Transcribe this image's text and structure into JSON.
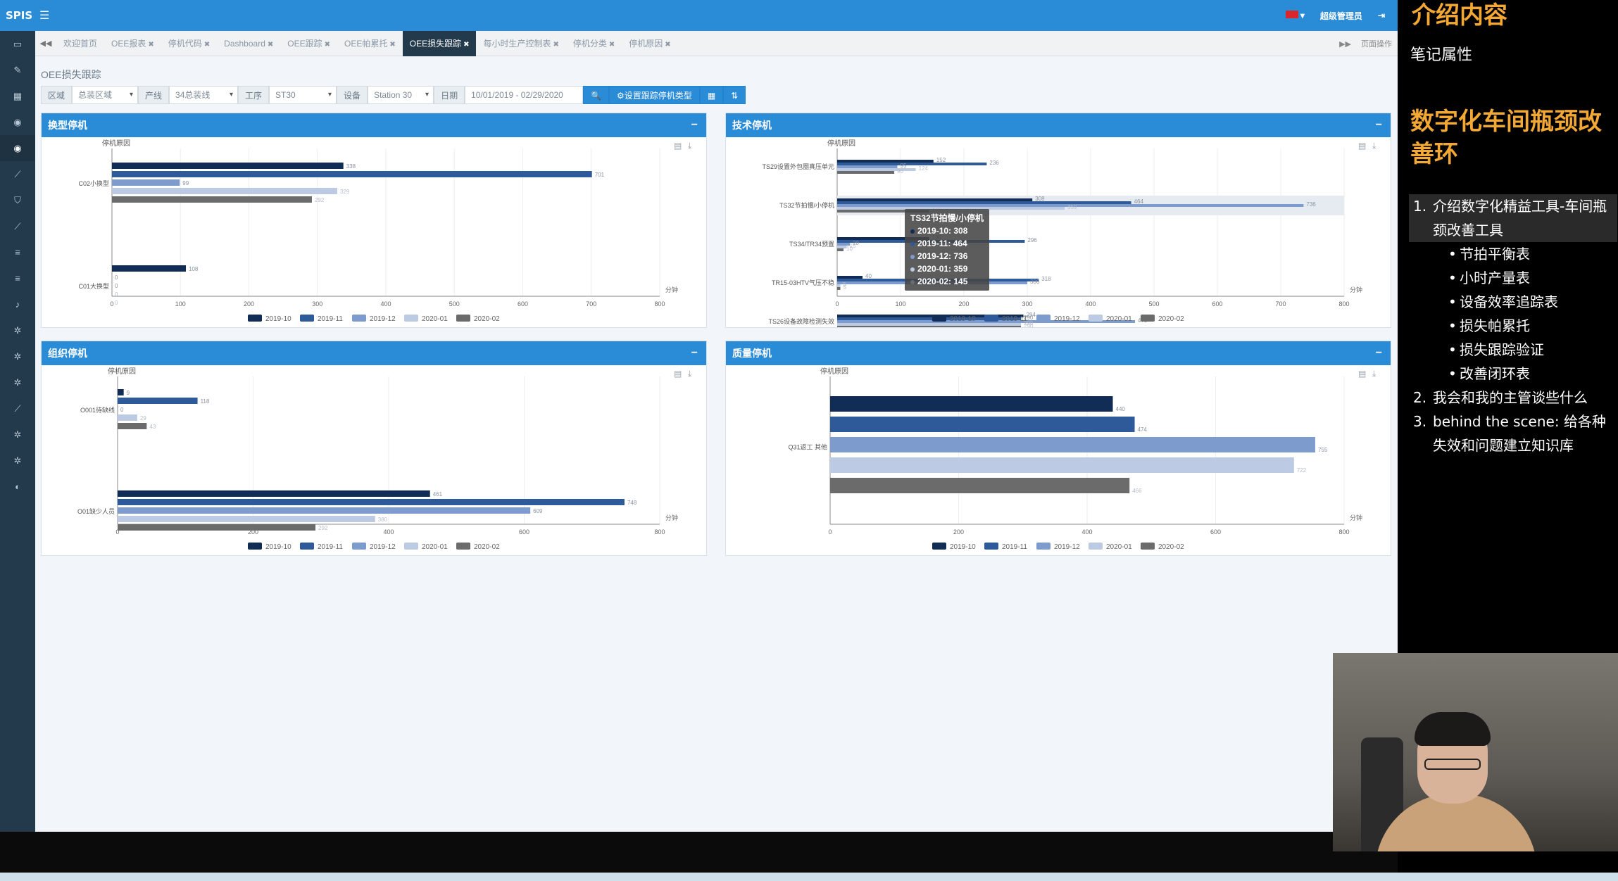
{
  "app": {
    "logo": "SPIS",
    "user_name": "超级管理员",
    "tabs": [
      {
        "label": "欢迎首页",
        "closable": false
      },
      {
        "label": "OEE报表",
        "closable": true
      },
      {
        "label": "停机代码",
        "closable": true
      },
      {
        "label": "Dashboard",
        "closable": true
      },
      {
        "label": "OEE跟踪",
        "closable": true
      },
      {
        "label": "OEE帕累托",
        "closable": true
      },
      {
        "label": "OEE损失跟踪",
        "closable": true
      },
      {
        "label": "每小时生产控制表",
        "closable": true
      },
      {
        "label": "停机分类",
        "closable": true
      },
      {
        "label": "停机原因",
        "closable": true
      }
    ],
    "active_tab": 6,
    "tab_actions": "页面操作",
    "page_title": "OEE损失跟踪",
    "filters": {
      "area_label": "区域",
      "area_value": "总装区域",
      "line_label": "产线",
      "line_value": "34总装线",
      "station_label": "工序",
      "station_value": "ST30",
      "device_label": "设备",
      "device_value": "Station 30",
      "date_label": "日期",
      "date_value": "10/01/2019 - 02/29/2020",
      "set_type_button": "设置跟踪停机类型"
    },
    "sidebar_icons": [
      "monitor-icon",
      "edit-icon",
      "calendar-icon",
      "camera-icon",
      "camera-icon",
      "chart-icon",
      "shield-icon",
      "chart-icon",
      "list-icon",
      "list-icon",
      "bell-icon",
      "gear-icon",
      "gear-icon",
      "gear-icon",
      "chart-icon",
      "gear-icon",
      "gears-icon",
      "dashboard-icon"
    ],
    "active_sidebar": 4
  },
  "panels": [
    {
      "title": "换型停机",
      "axis_title": "停机原因",
      "unit": "分钟"
    },
    {
      "title": "技术停机",
      "axis_title": "停机原因",
      "unit": "分钟"
    },
    {
      "title": "组织停机",
      "axis_title": "停机原因",
      "unit": "分钟"
    },
    {
      "title": "质量停机",
      "axis_title": "停机原因",
      "unit": "分钟"
    }
  ],
  "tooltip": {
    "title": "TS32节拍慢/小停机",
    "lines": [
      "2019-10: 308",
      "2019-11: 464",
      "2019-12: 736",
      "2020-01: 359",
      "2020-02: 145"
    ]
  },
  "chart_data": [
    {
      "type": "bar",
      "orientation": "horizontal",
      "title": "换型停机",
      "ylabel": "停机原因",
      "xlabel": "分钟",
      "categories": [
        "C02小换型",
        "C01大换型"
      ],
      "series": [
        {
          "name": "2019-10",
          "values": [
            338,
            108
          ]
        },
        {
          "name": "2019-11",
          "values": [
            701,
            0
          ]
        },
        {
          "name": "2019-12",
          "values": [
            99,
            0
          ]
        },
        {
          "name": "2020-01",
          "values": [
            329,
            0
          ]
        },
        {
          "name": "2020-02",
          "values": [
            292,
            0
          ]
        }
      ],
      "xlim": [
        0,
        800
      ],
      "xticks": [
        0,
        100,
        200,
        300,
        400,
        500,
        600,
        700,
        800
      ],
      "legend": "bottom"
    },
    {
      "type": "bar",
      "orientation": "horizontal",
      "title": "技术停机",
      "ylabel": "停机原因",
      "xlabel": "分钟",
      "categories": [
        "TS29设置外包圈真压单元",
        "TS32节拍慢/小停机",
        "TS34/TR34预置",
        "TR15-03HTV气压不稳",
        "TS26设备故障检测失效"
      ],
      "series": [
        {
          "name": "2019-10",
          "values": [
            152,
            308,
            145,
            40,
            294
          ]
        },
        {
          "name": "2019-11",
          "values": [
            236,
            464,
            296,
            318,
            290
          ]
        },
        {
          "name": "2019-12",
          "values": [
            95,
            736,
            20,
            300,
            470
          ]
        },
        {
          "name": "2020-01",
          "values": [
            124,
            359,
            15,
            5,
            290
          ]
        },
        {
          "name": "2020-02",
          "values": [
            90,
            145,
            10,
            5,
            290
          ]
        }
      ],
      "xlim": [
        0,
        800
      ],
      "xticks": [
        0,
        100,
        200,
        300,
        400,
        500,
        600,
        700,
        800
      ],
      "legend": "bottom"
    },
    {
      "type": "bar",
      "orientation": "horizontal",
      "title": "组织停机",
      "ylabel": "停机原因",
      "xlabel": "分钟",
      "categories": [
        "O001待缺线",
        "O01缺少人员"
      ],
      "series": [
        {
          "name": "2019-10",
          "values": [
            9,
            461
          ]
        },
        {
          "name": "2019-11",
          "values": [
            118,
            748
          ]
        },
        {
          "name": "2019-12",
          "values": [
            0,
            609
          ]
        },
        {
          "name": "2020-01",
          "values": [
            29,
            380
          ]
        },
        {
          "name": "2020-02",
          "values": [
            43,
            292
          ]
        }
      ],
      "xlim": [
        0,
        800
      ],
      "xticks": [
        0,
        200,
        400,
        600,
        800
      ],
      "legend": "bottom"
    },
    {
      "type": "bar",
      "orientation": "horizontal",
      "title": "质量停机",
      "ylabel": "停机原因",
      "xlabel": "分钟",
      "categories": [
        "Q31返工 其他"
      ],
      "series": [
        {
          "name": "2019-10",
          "values": [
            440
          ]
        },
        {
          "name": "2019-11",
          "values": [
            474
          ]
        },
        {
          "name": "2019-12",
          "values": [
            755
          ]
        },
        {
          "name": "2020-01",
          "values": [
            722
          ]
        },
        {
          "name": "2020-02",
          "values": [
            466
          ]
        }
      ],
      "xlim": [
        0,
        800
      ],
      "xticks": [
        0,
        200,
        400,
        600,
        800
      ],
      "legend": "bottom"
    }
  ],
  "series_colors": [
    "#112c55",
    "#2e5a9a",
    "#7d9bcc",
    "#bccbe3",
    "#6b6b6b"
  ],
  "notes": {
    "title": "介绍内容",
    "subtitle": "笔记属性",
    "heading": "数字化车间瓶颈改善环",
    "items": [
      {
        "num": "1.",
        "text": "介绍数字化精益工具-车间瓶颈改善工具",
        "highlight": true,
        "sub": [
          "节拍平衡表",
          "小时产量表",
          "设备效率追踪表",
          "损失帕累托",
          "损失跟踪验证",
          "改善闭环表"
        ]
      },
      {
        "num": "2.",
        "text": "我会和我的主管谈些什么",
        "highlight": false,
        "sub": []
      },
      {
        "num": "3.",
        "text": "behind the scene: 给各种失效和问题建立知识库",
        "highlight": false,
        "sub": []
      }
    ]
  }
}
